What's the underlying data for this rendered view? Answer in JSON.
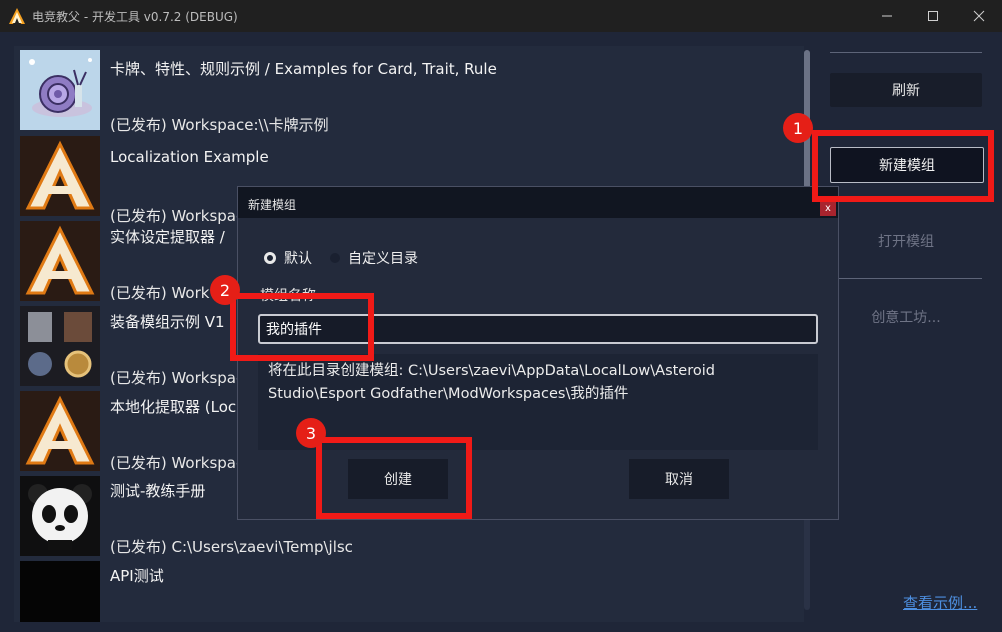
{
  "window": {
    "title": "电竞教父 - 开发工具 v0.7.2 (DEBUG)",
    "minimize_icon": "minimize-icon",
    "maximize_icon": "maximize-icon",
    "close_icon": "close-icon"
  },
  "list": {
    "items": [
      {
        "name": "卡牌、特性、规则示例 / Examples for Card, Trait, Rule",
        "workspace": "(已发布) Workspace:\\\\卡牌示例",
        "thumb": "snail"
      },
      {
        "name": "Localization Example",
        "workspace": "(已发布) Workspace",
        "thumb": "logo-a"
      },
      {
        "name": "实体设定提取器 /",
        "workspace": "(已发布) Work",
        "thumb": "logo-a"
      },
      {
        "name": "装备模组示例 V1",
        "workspace": "(已发布) Workspac",
        "thumb": "equipment"
      },
      {
        "name": "本地化提取器 (Loc",
        "workspace": "(已发布) Workspac",
        "thumb": "logo-a"
      },
      {
        "name": "测试-教练手册",
        "workspace": "(已发布) C:\\Users\\zaevi\\Temp\\jlsc",
        "thumb": "panda"
      },
      {
        "name": "API测试",
        "workspace": "",
        "thumb": "black"
      }
    ]
  },
  "sidebar": {
    "refresh": "刷新",
    "new_mod": "新建模组",
    "open_mod": "打开模组",
    "workshop": "创意工坊...",
    "examples_link": "查看示例..."
  },
  "dialog": {
    "title": "新建模组",
    "close": "x",
    "radio_default": "默认",
    "radio_custom": "自定义目录",
    "name_label": "模组名称",
    "name_value": "我的插件",
    "path_text": "将在此目录创建模组: C:\\Users\\zaevi\\AppData\\LocalLow\\Asteroid Studio\\Esport Godfather\\ModWorkspaces\\我的插件",
    "create": "创建",
    "cancel": "取消"
  },
  "annotations": {
    "badge1": "1",
    "badge2": "2",
    "badge3": "3",
    "color": "#f01a17"
  }
}
